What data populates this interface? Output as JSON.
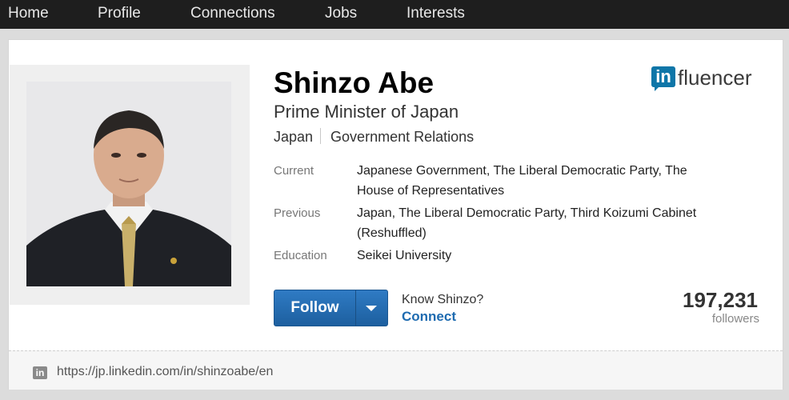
{
  "nav": {
    "items": [
      "Home",
      "Profile",
      "Connections",
      "Jobs",
      "Interests"
    ]
  },
  "profile": {
    "name": "Shinzo Abe",
    "headline": "Prime Minister of Japan",
    "location": "Japan",
    "industry": "Government Relations",
    "info": [
      {
        "label": "Current",
        "value_lines": [
          "Japanese Government, The Liberal Democratic Party, The",
          "House of Representatives"
        ]
      },
      {
        "label": "Previous",
        "value_lines": [
          "Japan, The Liberal Democratic Party, Third Koizumi Cabinet",
          "(Reshuffled)"
        ]
      },
      {
        "label": "Education",
        "value_lines": [
          "Seikei University"
        ]
      }
    ]
  },
  "badge": {
    "in": "in",
    "word": "fluencer",
    "brand_color": "#0e76a8"
  },
  "actions": {
    "follow_label": "Follow",
    "know_text": "Know Shinzo?",
    "connect_label": "Connect"
  },
  "followers": {
    "count": "197,231",
    "label": "followers"
  },
  "footer": {
    "icon": "in",
    "url": "https://jp.linkedin.com/in/shinzoabe/en"
  }
}
